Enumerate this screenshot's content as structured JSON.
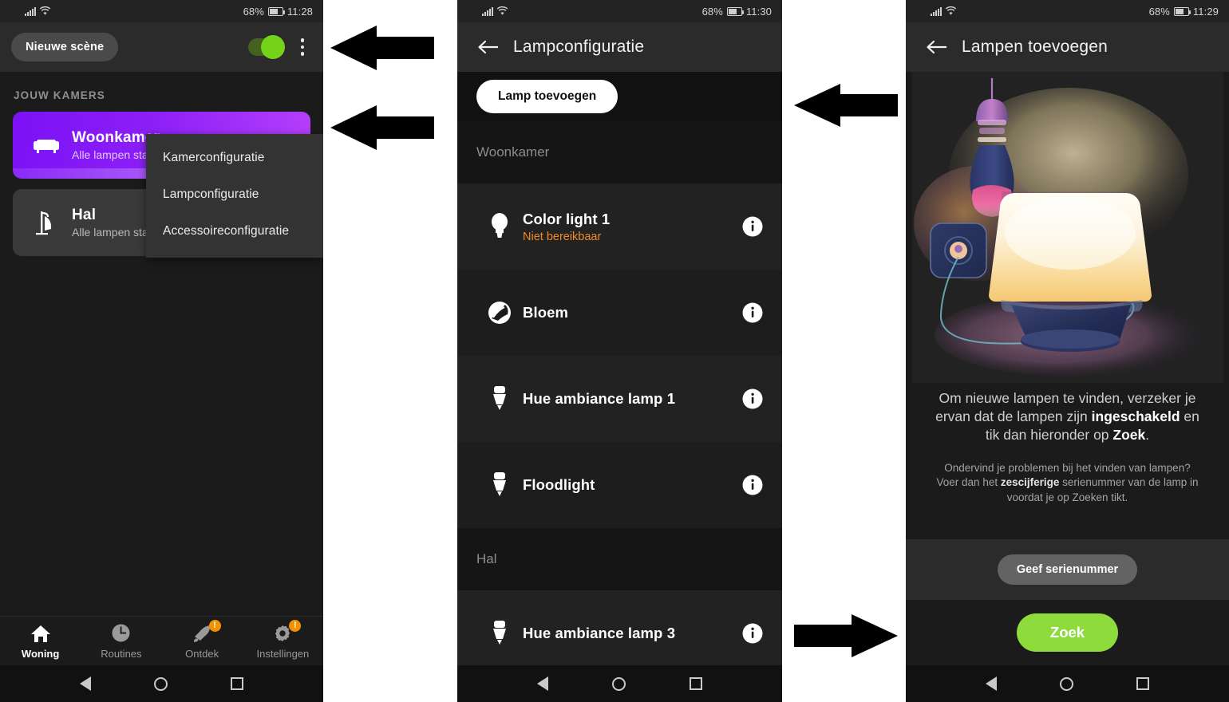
{
  "statusbar": {
    "battery_pct": "68%",
    "time_home": "11:28",
    "time_lamp": "11:30",
    "time_add": "11:29"
  },
  "home": {
    "scene_button": "Nieuwe scène",
    "section_label": "JOUW KAMERS",
    "rooms": [
      {
        "name": "Woonkamer",
        "subtitle": "Alle lampen staan aan",
        "state": "on",
        "icon": "sofa-icon"
      },
      {
        "name": "Hal",
        "subtitle": "Alle lampen staan uit",
        "state": "off",
        "icon": "coat-rack-icon"
      }
    ],
    "menu": [
      "Kamerconfiguratie",
      "Lampconfiguratie",
      "Accessoireconfiguratie"
    ],
    "nav": [
      {
        "label": "Woning",
        "icon": "home-icon",
        "active": true,
        "badge": ""
      },
      {
        "label": "Routines",
        "icon": "clock-icon",
        "active": false,
        "badge": ""
      },
      {
        "label": "Ontdek",
        "icon": "rocket-icon",
        "active": false,
        "badge": "!"
      },
      {
        "label": "Instellingen",
        "icon": "gear-icon",
        "active": false,
        "badge": "!"
      }
    ]
  },
  "lampconfig": {
    "title": "Lampconfiguratie",
    "add_button": "Lamp toevoegen",
    "groups": [
      {
        "name": "Woonkamer",
        "lamps": [
          {
            "name": "Color light 1",
            "status": "Niet bereikbaar",
            "icon": "bulb-icon"
          },
          {
            "name": "Bloem",
            "status": "",
            "icon": "bloom-lamp-icon"
          },
          {
            "name": "Hue ambiance lamp 1",
            "status": "",
            "icon": "spot-bulb-icon"
          },
          {
            "name": "Floodlight",
            "status": "",
            "icon": "spot-bulb-icon"
          }
        ]
      },
      {
        "name": "Hal",
        "lamps": [
          {
            "name": "Hue ambiance lamp 3",
            "status": "",
            "icon": "spot-bulb-icon"
          }
        ]
      }
    ]
  },
  "addlamps": {
    "title": "Lampen toevoegen",
    "instruction_parts": {
      "p1": "Om nieuwe lampen te vinden, verzeker je ervan dat de lampen zijn ",
      "bold1": "ingeschakeld",
      "p2": " en tik dan hieronder op ",
      "bold2": "Zoek",
      "p3": "."
    },
    "help_parts": {
      "h1": "Ondervind je problemen bij het vinden van lampen? Voer dan het ",
      "bold1": "zescijferige",
      "h2": " serienummer van de lamp in voordat je op Zoeken tikt."
    },
    "serial_button": "Geef serienummer",
    "search_button": "Zoek"
  },
  "colors": {
    "accent_green": "#8ddc3b",
    "room_purple": "#8c1ff7",
    "warning_orange": "#f08a24",
    "badge_orange": "#f39200"
  }
}
